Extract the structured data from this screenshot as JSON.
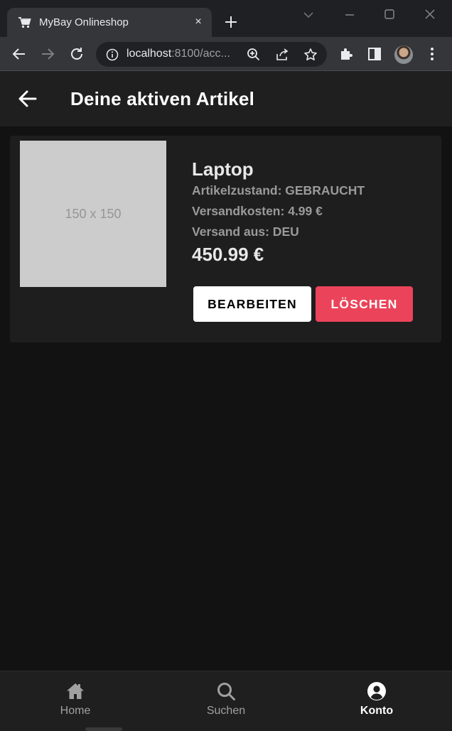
{
  "browser": {
    "tab_title": "MyBay Onlineshop",
    "tab_close": "×",
    "url_host": "localhost",
    "url_rest": ":8100/acc..."
  },
  "header": {
    "title": "Deine aktiven Artikel"
  },
  "item": {
    "image_placeholder": "150 x 150",
    "name": "Laptop",
    "condition": "Artikelzustand: GEBRAUCHT",
    "shipping_cost": "Versandkosten: 4.99 €",
    "ships_from": "Versand aus: DEU",
    "price": "450.99 €",
    "edit_label": "BEARBEITEN",
    "delete_label": "LÖSCHEN"
  },
  "tabbar": {
    "items": [
      {
        "label": "Home",
        "icon": "home-icon",
        "active": false
      },
      {
        "label": "Suchen",
        "icon": "search-icon",
        "active": false
      },
      {
        "label": "Konto",
        "icon": "person-circle-icon",
        "active": true
      }
    ]
  },
  "colors": {
    "background": "#121212",
    "surface": "#1e1e1e",
    "danger": "#eb445a",
    "text_secondary": "#9a9a9a"
  }
}
